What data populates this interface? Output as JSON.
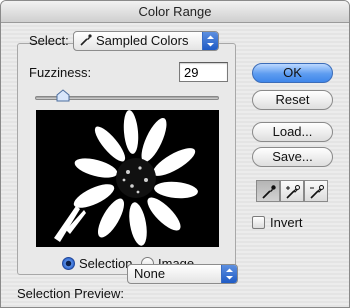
{
  "window": {
    "title": "Color Range"
  },
  "select": {
    "label": "Select:",
    "value": "Sampled Colors"
  },
  "fuzziness": {
    "label": "Fuzziness:",
    "value": "29",
    "slider_fraction": 0.15
  },
  "view": {
    "options": [
      {
        "label": "Selection",
        "selected": true
      },
      {
        "label": "Image",
        "selected": false
      }
    ]
  },
  "selection_preview": {
    "label": "Selection Preview:",
    "value": "None"
  },
  "buttons": {
    "ok": "OK",
    "reset": "Reset",
    "load": "Load...",
    "save": "Save..."
  },
  "eyedroppers": [
    {
      "icon": "eyedropper-icon",
      "active": true
    },
    {
      "icon": "eyedropper-plus-icon",
      "active": false
    },
    {
      "icon": "eyedropper-minus-icon",
      "active": false
    }
  ],
  "invert": {
    "label": "Invert",
    "checked": false
  },
  "colors": {
    "accent": "#3f86ea",
    "preview_bg": "#000000"
  }
}
